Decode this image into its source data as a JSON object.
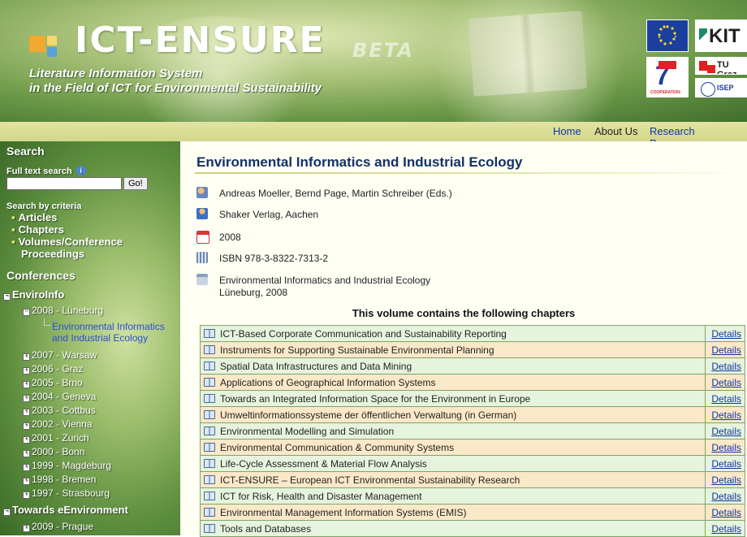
{
  "header": {
    "logo_text": "ICT-ENSURE",
    "beta_label": "BETA",
    "tagline_1": "Literature Information System",
    "tagline_2": "in the Field of ICT for Environmental Sustainability",
    "partners": [
      "KIT",
      "TU Graz",
      "COOPERATION",
      "ISEP"
    ]
  },
  "nav": {
    "items": [
      "Home",
      "About Us",
      "Research Programmes"
    ]
  },
  "sidebar": {
    "search_title": "Search",
    "full_text_label": "Full text search",
    "search_input_value": "",
    "go_label": "Go!",
    "criteria_title": "Search by criteria",
    "criteria": [
      "Articles",
      "Chapters",
      "Volumes/Conference",
      "Proceedings"
    ],
    "conferences_title": "Conferences",
    "tree": {
      "root_enviroinfo": "EnviroInfo",
      "selected_year": "2008 - Lüneburg",
      "selected_volume_line1": "Environmental Informatics",
      "selected_volume_line2": "and Industrial Ecology",
      "years": [
        "2007 - Warsaw",
        "2006 - Graz",
        "2005 - Brno",
        "2004 - Geneva",
        "2003 - Cottbus",
        "2002 - Vienna",
        "2001 - Zurich",
        "2000 - Bonn",
        "1999 - Magdeburg",
        "1998 - Bremen",
        "1997 - Strasbourg"
      ],
      "root_eenv": "Towards eEnvironment",
      "eenv_year": "2009 - Prague"
    }
  },
  "main": {
    "title": "Environmental Informatics and Industrial Ecology",
    "editors": "Andreas Moeller, Bernd Page, Martin Schreiber (Eds.)",
    "publisher": "Shaker Verlag, Aachen",
    "year": "2008",
    "isbn": "ISBN 978-3-8322-7313-2",
    "conference_line1": "Environmental Informatics and Industrial Ecology",
    "conference_line2": "Lüneburg, 2008",
    "contains_heading": "This volume contains the following chapters",
    "details_label": "Details",
    "chapters": [
      "ICT-Based Corporate Communication and Sustainability Reporting",
      "Instruments for Supporting Sustainable Environmental Planning",
      "Spatial Data Infrastructures and Data Mining",
      "Applications of Geographical Information Systems",
      "Towards an Integrated Information Space for the Environment in Europe",
      "Umweltinformationssysteme der öffentlichen Verwaltung (in German)",
      "Environmental Modelling and Simulation",
      "Environmental Communication & Community Systems",
      "Life-Cycle Assessment & Material Flow Analysis",
      "ICT-ENSURE – European ICT Environmental Sustainability Research",
      "ICT for Risk, Health and Disaster Management",
      "Environmental Management Information Systems (EMIS)",
      "Tools and Databases"
    ]
  },
  "colors": {
    "title_navy": "#123266",
    "nav_link": "#1035a8",
    "row_green": "#e6f4dd",
    "row_peach": "#fbe8c8"
  }
}
